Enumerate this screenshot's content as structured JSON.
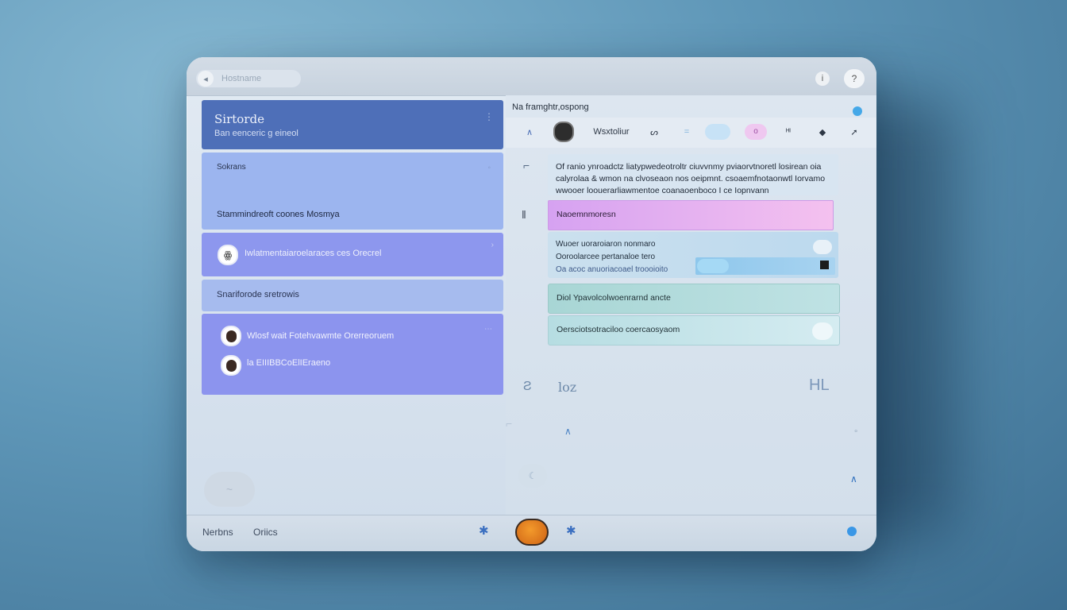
{
  "titlebar": {
    "back_icon": "back-arrow-icon",
    "title": "Hostname",
    "right_icon_1": "i",
    "right_icon_2": "?"
  },
  "left": {
    "card1": {
      "title": "Sirtorde",
      "subtitle": "Ban eenceric g eineol",
      "icon": "⋮"
    },
    "card2": {
      "label": "Sokrans",
      "text": "Stammindreoft coones Mosmya"
    },
    "card3": {
      "text": "Iwlatmentaiaroelaraces ces Orecrel",
      "avatar": "ꙮ"
    },
    "card4": {
      "text": "Snariforode sretrowis"
    },
    "card5": {
      "row1": "Wlosf wait Fotehvawmte Orerreoruem",
      "row2": "la EIIIBBCoElIEraeno"
    }
  },
  "right": {
    "title": "Na framghtr,ospong",
    "toolbar_label": "Wsxtoliur",
    "note_text": "Of ranio ynroadctz liatypwedeotroltr ciuvvnmy pviaorvtnoretl losirean oia calyrolaa & wmon na clvoseaon nos oeipmnt. csoaemfnotaonwtl Iorvamo wwooer loouerarliawmentoe coanaoenboco I ce Iopnvann",
    "selected_item": "Naoemnmoresn",
    "block_line1": "Wuoer uoraroiaron nonmaro",
    "block_line2": "Ooroolarcee pertanaloe tero",
    "block_line3": "Oa acoc anuoriacoael troooioito",
    "teal1": "Diol Ypavolcolwoenrarnd ancte",
    "teal2": "Oersciotsotraciloo coercaosyaom",
    "glyph1": "Ƨ",
    "glyph2": "loz",
    "glyph3": "HL"
  },
  "bottombar": {
    "tab1": "Nerbns",
    "tab2": "Oriics"
  }
}
